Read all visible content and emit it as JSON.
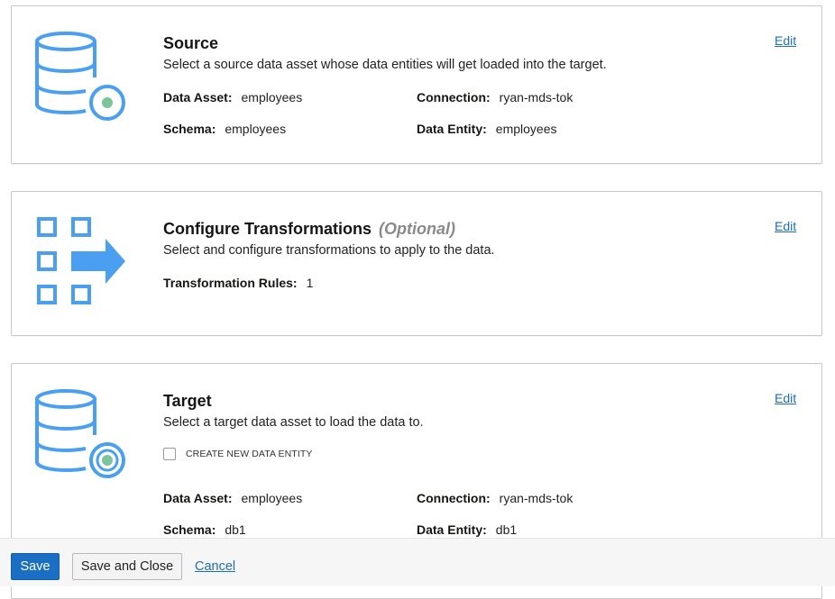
{
  "source": {
    "title": "Source",
    "description": "Select a source data asset whose data entities will get loaded into the target.",
    "edit_label": "Edit",
    "fields": {
      "data_asset_label": "Data Asset:",
      "data_asset_value": "employees",
      "connection_label": "Connection:",
      "connection_value": "ryan-mds-tok",
      "schema_label": "Schema:",
      "schema_value": "employees",
      "data_entity_label": "Data Entity:",
      "data_entity_value": "employees"
    },
    "icon": "database-source-icon"
  },
  "transform": {
    "title": "Configure Transformations",
    "optional_label": "(Optional)",
    "description": "Select and configure transformations to apply to the data.",
    "edit_label": "Edit",
    "rules_label": "Transformation Rules:",
    "rules_value": "1",
    "icon": "transform-arrow-icon"
  },
  "target": {
    "title": "Target",
    "description": "Select a target data asset to load the data to.",
    "edit_label": "Edit",
    "create_new_label": "CREATE NEW DATA ENTITY",
    "create_new_checked": false,
    "fields": {
      "data_asset_label": "Data Asset:",
      "data_asset_value": "employees",
      "connection_label": "Connection:",
      "connection_value": "ryan-mds-tok",
      "schema_label": "Schema:",
      "schema_value": "db1",
      "data_entity_label": "Data Entity:",
      "data_entity_value": "db1"
    },
    "icon": "database-target-icon"
  },
  "footer": {
    "save_label": "Save",
    "save_close_label": "Save and Close",
    "cancel_label": "Cancel"
  },
  "colors": {
    "icon_blue": "#4a9ff0",
    "icon_green": "#7cc49a",
    "primary_button": "#1a6fc4",
    "link": "#1e6eb5"
  }
}
